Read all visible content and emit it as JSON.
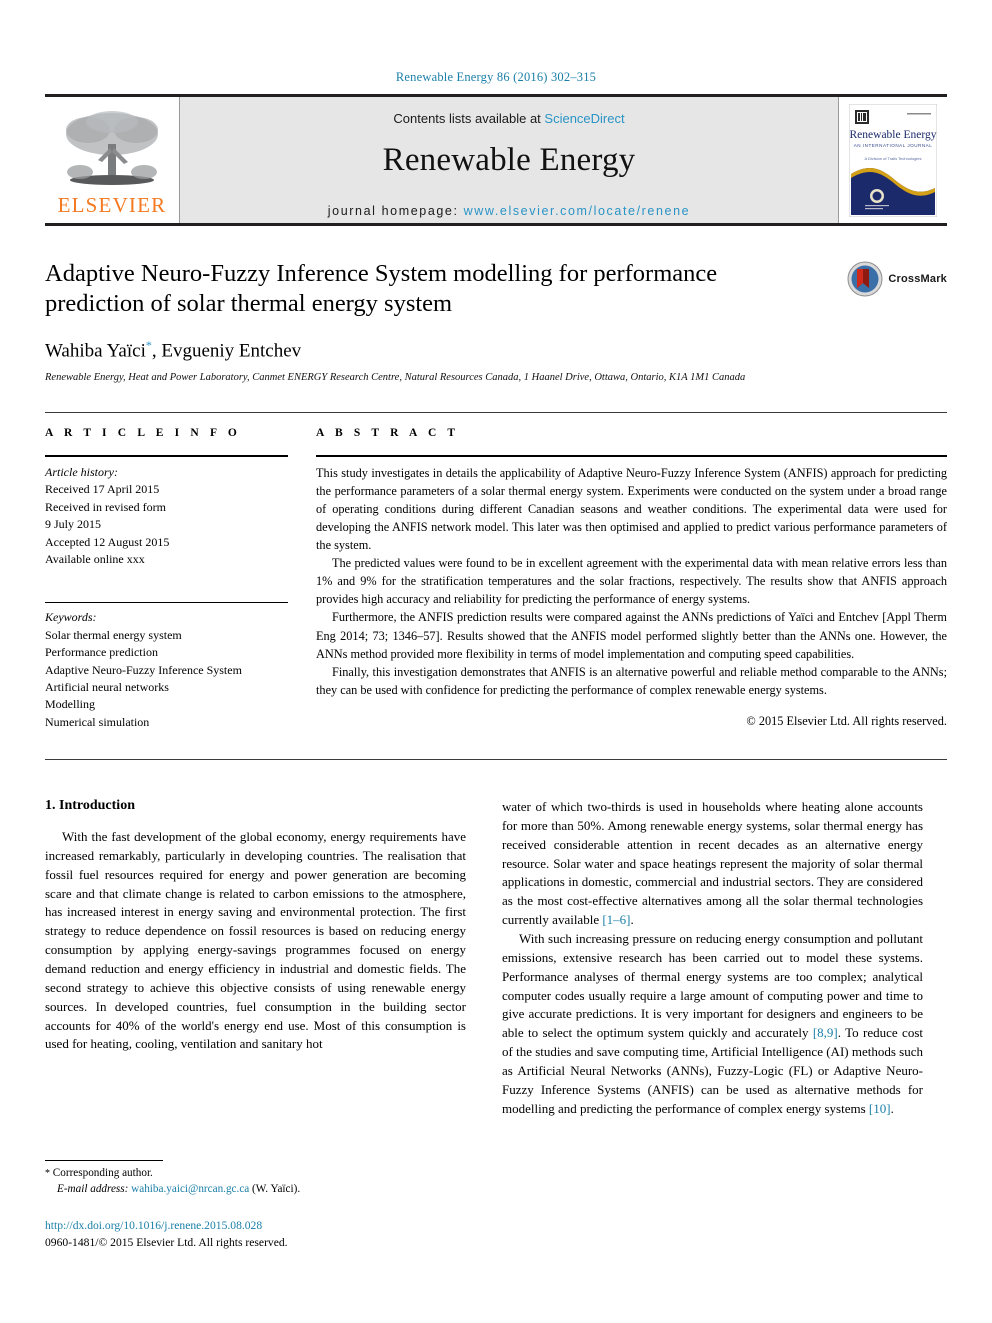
{
  "running_head": "Renewable Energy 86 (2016) 302–315",
  "masthead": {
    "publisher_name": "ELSEVIER",
    "contents_prefix": "Contents lists available at ",
    "contents_link": "ScienceDirect",
    "journal_title": "Renewable Energy",
    "homepage_prefix": "journal homepage: ",
    "homepage_url": "www.elsevier.com/locate/renene",
    "cover": {
      "title": "Renewable Energy",
      "subtitle": "AN INTERNATIONAL JOURNAL",
      "strapline": "A Division of Trails Technologies"
    }
  },
  "article": {
    "title": "Adaptive Neuro-Fuzzy Inference System modelling for performance prediction of solar thermal energy system",
    "authors": "Wahiba Yaïci",
    "authors_rest": ", Evgueniy Entchev",
    "author_marker": "*",
    "affiliation": "Renewable Energy, Heat and Power Laboratory, Canmet ENERGY Research Centre, Natural Resources Canada, 1 Haanel Drive, Ottawa, Ontario, K1A 1M1 Canada",
    "crossmark_label": "CrossMark"
  },
  "article_info": {
    "heading": "A R T I C L E   I N F O",
    "history_label": "Article history:",
    "history": [
      "Received 17 April 2015",
      "Received in revised form",
      "9 July 2015",
      "Accepted 12 August 2015",
      "Available online xxx"
    ],
    "keywords_label": "Keywords:",
    "keywords": [
      "Solar thermal energy system",
      "Performance prediction",
      "Adaptive Neuro-Fuzzy Inference System",
      "Artificial neural networks",
      "Modelling",
      "Numerical simulation"
    ]
  },
  "abstract": {
    "heading": "A B S T R A C T",
    "paragraphs": [
      "This study investigates in details the applicability of Adaptive Neuro-Fuzzy Inference System (ANFIS) approach for predicting the performance parameters of a solar thermal energy system. Experiments were conducted on the system under a broad range of operating conditions during different Canadian seasons and weather conditions. The experimental data were used for developing the ANFIS network model. This later was then optimised and applied to predict various performance parameters of the system.",
      "The predicted values were found to be in excellent agreement with the experimental data with mean relative errors less than 1% and 9% for the stratification temperatures and the solar fractions, respectively. The results show that ANFIS approach provides high accuracy and reliability for predicting the performance of energy systems.",
      "Furthermore, the ANFIS prediction results were compared against the ANNs predictions of Yaïci and Entchev [Appl Therm Eng 2014; 73; 1346–57]. Results showed that the ANFIS model performed slightly better than the ANNs one. However, the ANNs method provided more flexibility in terms of model implementation and computing speed capabilities.",
      "Finally, this investigation demonstrates that ANFIS is an alternative powerful and reliable method comparable to the ANNs; they can be used with confidence for predicting the performance of complex renewable energy systems."
    ],
    "copyright": "© 2015 Elsevier Ltd. All rights reserved."
  },
  "body": {
    "section_heading": "1. Introduction",
    "left_paragraphs": [
      "With the fast development of the global economy, energy requirements have increased remarkably, particularly in developing countries. The realisation that fossil fuel resources required for energy and power generation are becoming scare and that climate change is related to carbon emissions to the atmosphere, has increased interest in energy saving and environmental protection. The first strategy to reduce dependence on fossil resources is based on reducing energy consumption by applying energy-savings programmes focused on energy demand reduction and energy efficiency in industrial and domestic fields. The second strategy to achieve this objective consists of using renewable energy sources. In developed countries, fuel consumption in the building sector accounts for 40% of the world's energy end use. Most of this consumption is used for heating, cooling, ventilation and sanitary hot"
    ],
    "right_paragraph_1_pre": "water of which two-thirds is used in households where heating alone accounts for more than 50%. Among renewable energy systems, solar thermal energy has received considerable attention in recent decades as an alternative energy resource. Solar water and space heatings represent the majority of solar thermal applications in domestic, commercial and industrial sectors. They are considered as the most cost-effective alternatives among all the solar thermal technologies currently available ",
    "right_paragraph_1_ref": "[1–6]",
    "right_paragraph_1_post": ".",
    "right_paragraph_2_pre": "With such increasing pressure on reducing energy consumption and pollutant emissions, extensive research has been carried out to model these systems. Performance analyses of thermal energy systems are too complex; analytical computer codes usually require a large amount of computing power and time to give accurate predictions. It is very important for designers and engineers to be able to select the optimum system quickly and accurately ",
    "right_paragraph_2_ref1": "[8,9]",
    "right_paragraph_2_mid": ". To reduce cost of the studies and save computing time, Artificial Intelligence (AI) methods such as Artificial Neural Networks (ANNs), Fuzzy-Logic (FL) or Adaptive Neuro-Fuzzy Inference Systems (ANFIS) can be used as alternative methods for modelling and predicting the performance of complex energy systems ",
    "right_paragraph_2_ref2": "[10]",
    "right_paragraph_2_post": "."
  },
  "footnotes": {
    "corresponding_marker": "*",
    "corresponding_text": "Corresponding author.",
    "email_label": "E-mail address:",
    "email": "wahiba.yaici@nrcan.gc.ca",
    "email_attrib": "(W. Yaïci).",
    "doi": "http://dx.doi.org/10.1016/j.renene.2015.08.028",
    "issn_line": "0960-1481/© 2015 Elsevier Ltd. All rights reserved."
  },
  "colors": {
    "link_blue": "#1a7fa8",
    "sciencedirect_blue": "#2a94c6",
    "elsevier_orange": "#F47920",
    "cover_navy": "#1b2a6b"
  }
}
